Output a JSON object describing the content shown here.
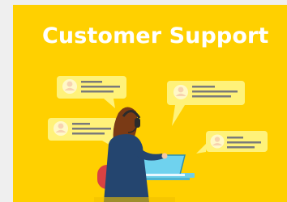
{
  "header": {
    "title": "Customer Support"
  },
  "colors": {
    "background": "#ffd000",
    "bubble": "#fff27a",
    "bubble_lines": "#7a7a7a",
    "avatar": "#f7d3b0",
    "hair": "#7a3a15",
    "headset": "#2b2b2b",
    "shirt": "#24456f",
    "chair": "#d94242",
    "laptop_screen": "#6fd2ee",
    "desk": "#6fcfe9"
  },
  "illustration": {
    "chat_bubbles": [
      {
        "avatar_icon": "user-avatar-icon"
      },
      {
        "avatar_icon": "user-avatar-icon"
      },
      {
        "avatar_icon": "user-avatar-icon"
      },
      {
        "avatar_icon": "user-avatar-icon"
      }
    ],
    "agent": "support-agent-figure"
  }
}
